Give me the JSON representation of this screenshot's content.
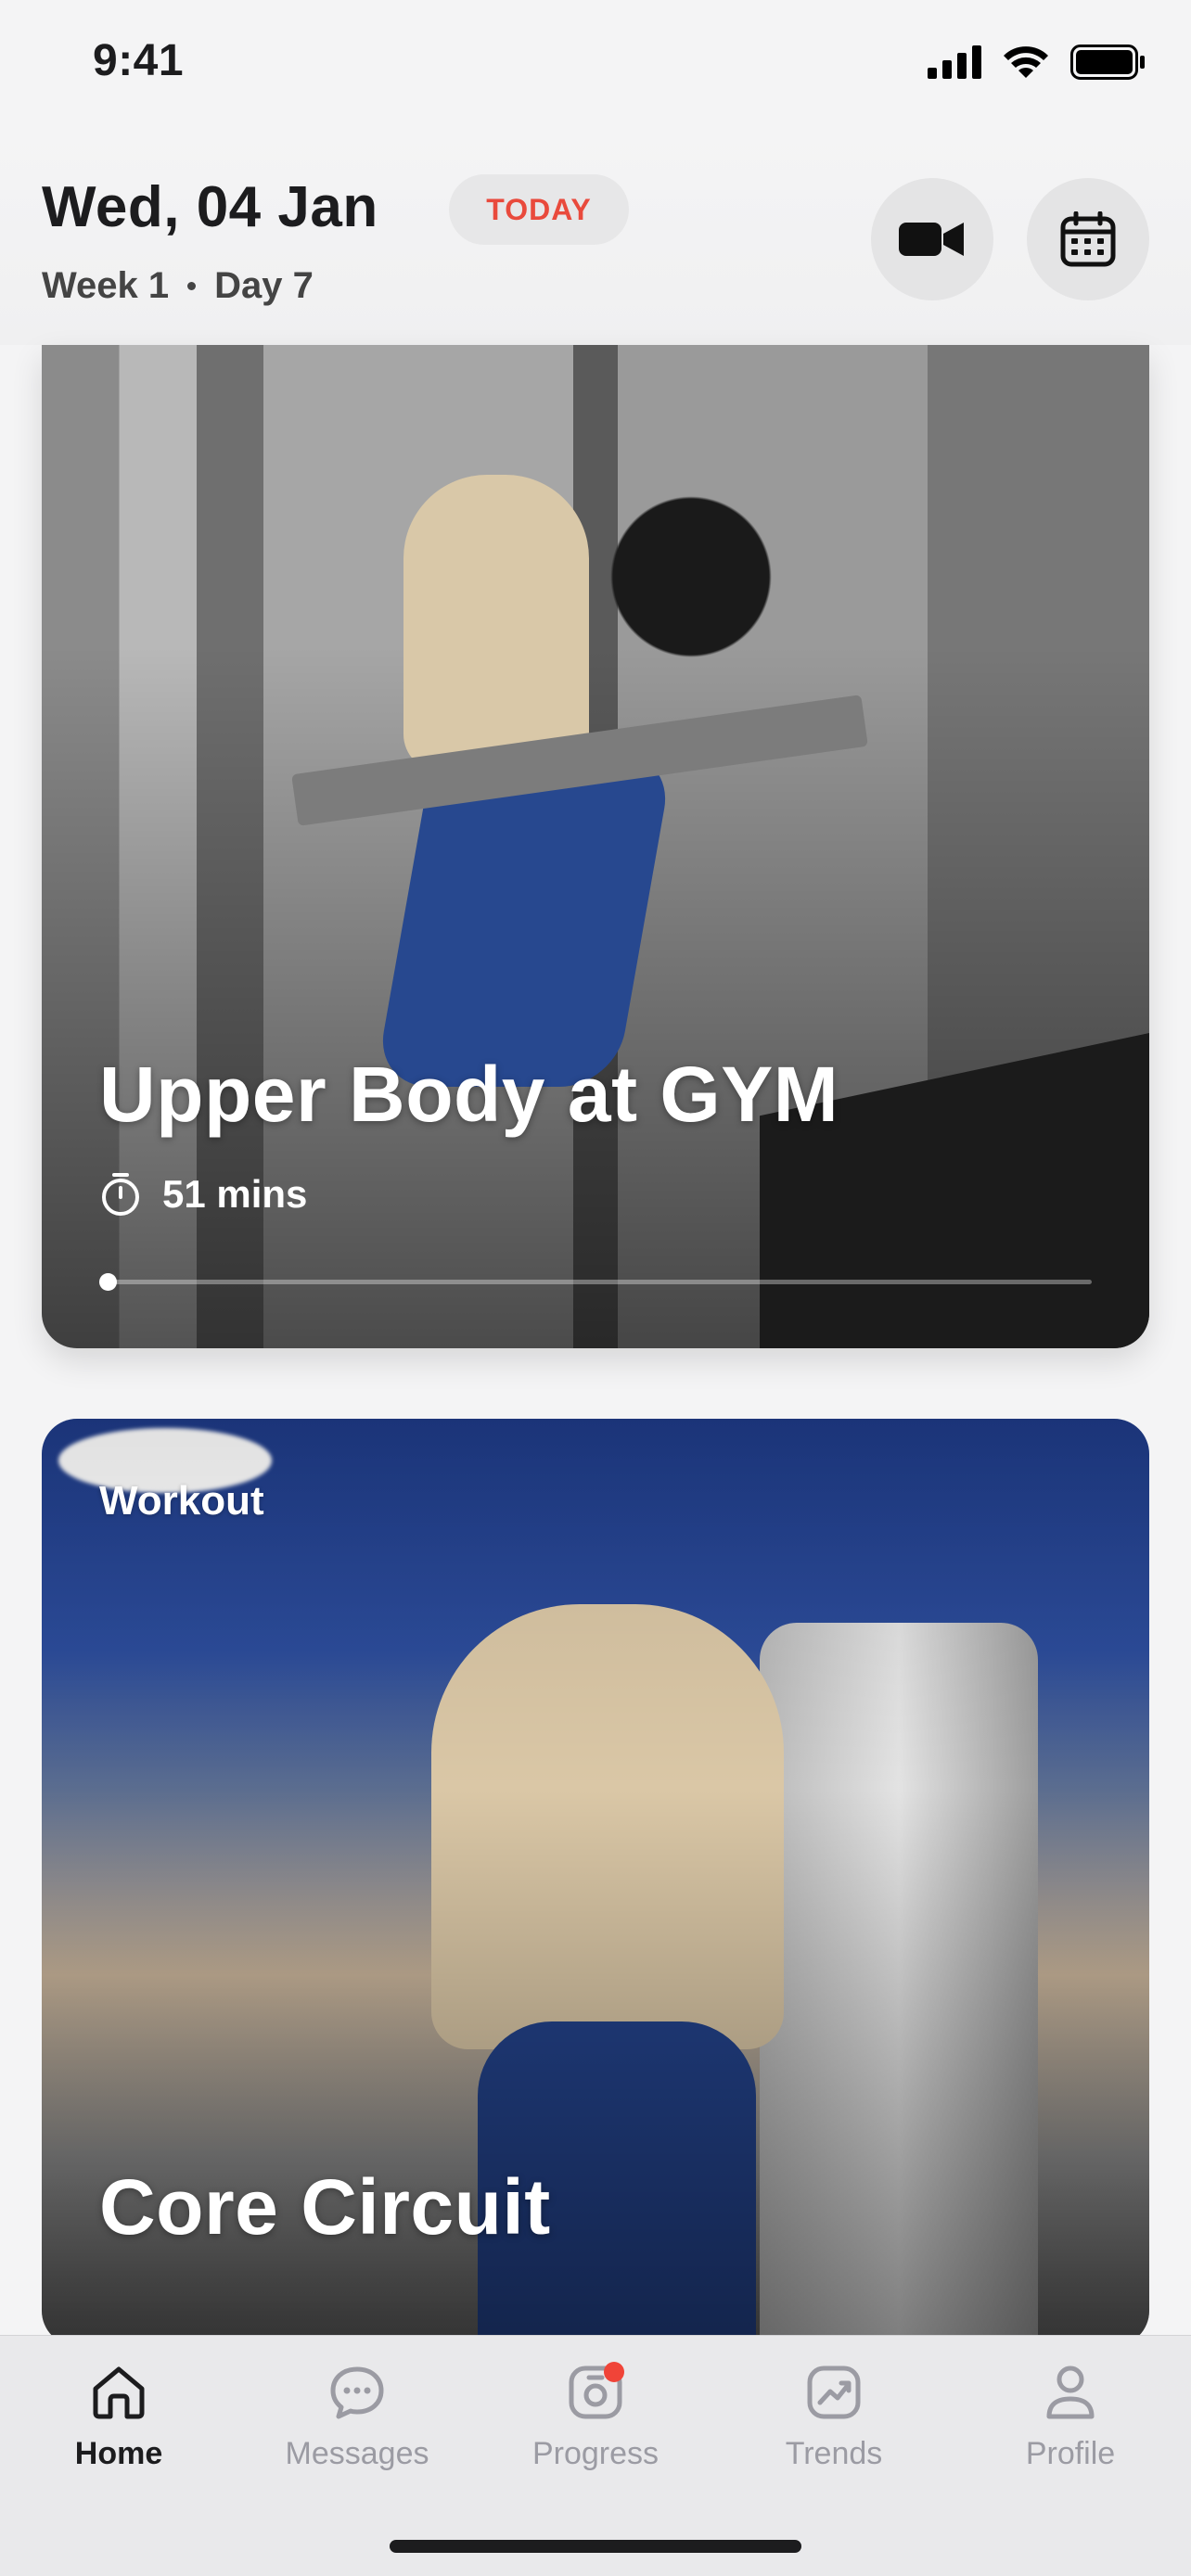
{
  "status": {
    "time": "9:41"
  },
  "header": {
    "date": "Wed, 04 Jan",
    "today_badge": "TODAY",
    "week": "Week 1",
    "day": "Day 7"
  },
  "cards": [
    {
      "title": "Upper Body at GYM",
      "duration": "51 mins",
      "progress": 0.0
    },
    {
      "category": "Workout",
      "title": "Core Circuit"
    }
  ],
  "tabbar": {
    "items": [
      {
        "label": "Home",
        "icon": "home-icon",
        "active": true
      },
      {
        "label": "Messages",
        "icon": "chat-icon",
        "active": false
      },
      {
        "label": "Progress",
        "icon": "camera-icon",
        "active": false,
        "badge": true
      },
      {
        "label": "Trends",
        "icon": "trend-chart-icon",
        "active": false
      },
      {
        "label": "Profile",
        "icon": "person-icon",
        "active": false
      }
    ]
  },
  "colors": {
    "accent": "#e94a3c",
    "badge": "#f04438",
    "inactive": "#9b9ba3"
  }
}
